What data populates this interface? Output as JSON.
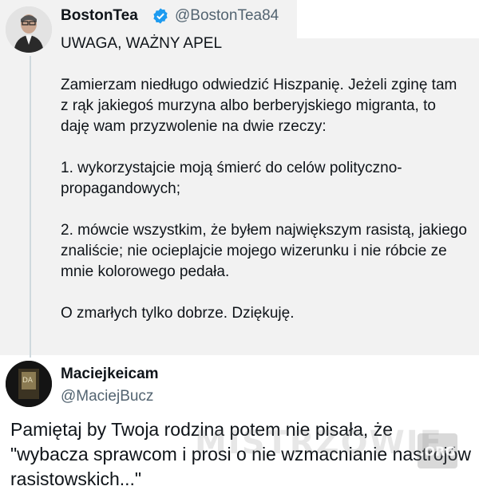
{
  "tweet1": {
    "name": "BostonTea",
    "handle": "@BostonTea84",
    "verified_color": "#1d9bf0",
    "body": "UWAGA, WAŻNY APEL\n\nZamierzam niedługo odwiedzić Hiszpanię. Jeżeli zginę tam z rąk jakiegoś murzyna albo berberyjskiego migranta, to daję wam przyzwolenie na dwie rzeczy:\n\n1. wykorzystajcie moją śmierć do celów polityczno-propagandowych;\n\n2. mówcie wszystkim, że byłem największym rasistą, jakiego znaliście; nie ocieplajcie mojego wizerunku i nie róbcie ze mnie kolorowego pedała.\n\nO zmarłych tylko dobrze. Dziękuję."
  },
  "tweet2": {
    "name": "Maciejkeicam",
    "handle": "@MaciejBucz",
    "body": "Pamiętaj by Twoja rodzina potem nie pisała, że \"wybacza sprawcom i prosi o nie wzmacnianie nastrojów rasistowskich...\""
  },
  "watermark": {
    "text": "MISTRZOWIE",
    "badge": ".ORG"
  }
}
